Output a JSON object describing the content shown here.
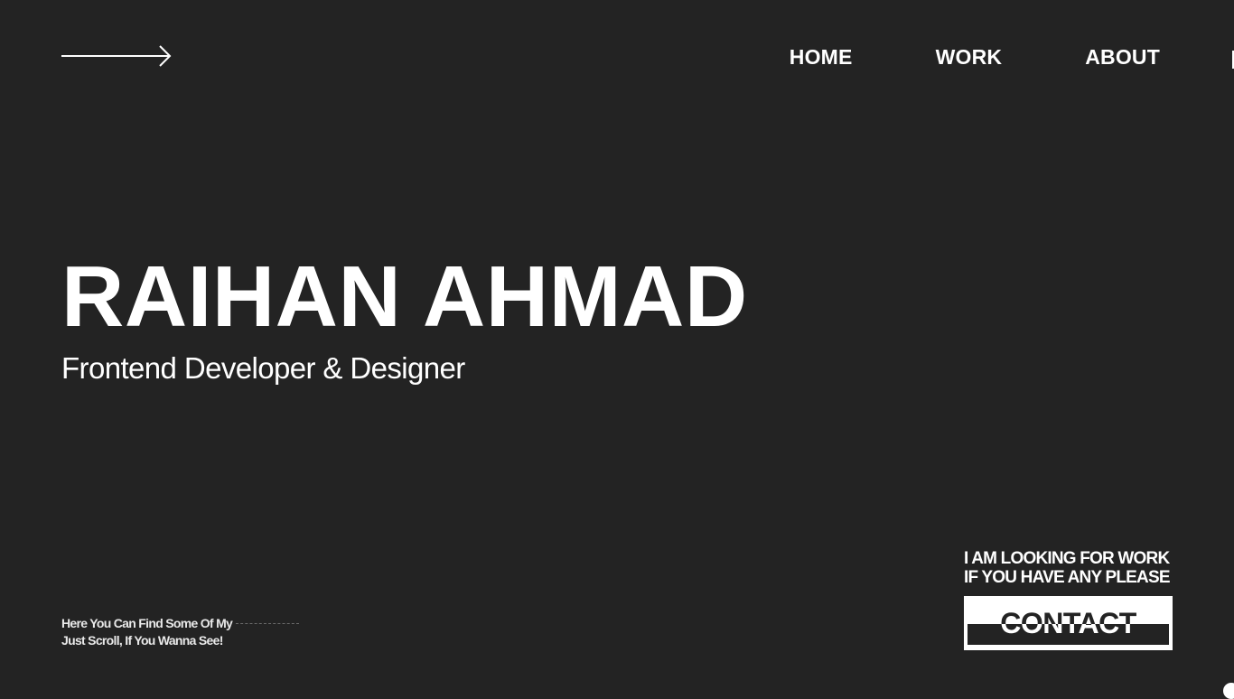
{
  "header": {
    "arrow_icon": "arrow-right-icon",
    "nav": [
      {
        "label": "HOME"
      },
      {
        "label": "WORK"
      },
      {
        "label": "ABOUT"
      }
    ]
  },
  "hero": {
    "name": "RAIHAN AHMAD",
    "role": "Frontend Developer & Designer"
  },
  "scroll_hint": {
    "line1": "Here You Can Find Some Of My",
    "line2": "Just Scroll, If You Wanna See!"
  },
  "cta": {
    "line1": "I AM LOOKING FOR WORK",
    "line2": "IF YOU HAVE ANY PLEASE",
    "button_label": "CONTACT"
  },
  "colors": {
    "background": "#232323",
    "foreground": "#ffffff"
  }
}
